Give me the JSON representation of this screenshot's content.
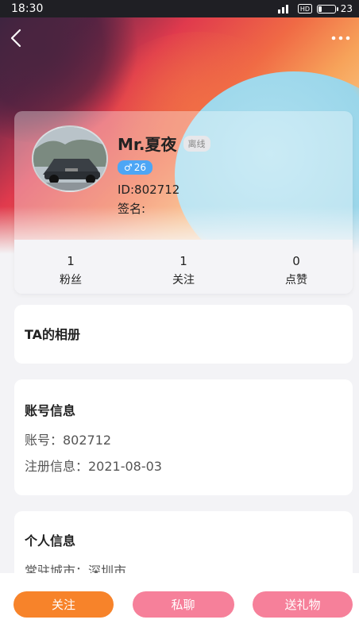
{
  "status_bar": {
    "time": "18:30",
    "battery": "23",
    "battery_fraction": 0.23
  },
  "nav": {
    "back_icon": "back-arrow-icon",
    "more_icon": "more-dots-icon"
  },
  "profile": {
    "name": "Mr.夏夜",
    "online_status": "离线",
    "gender_symbol": "♂",
    "age": "26",
    "id_line": "ID:802712",
    "signature_line": "签名:"
  },
  "stats": [
    {
      "value": "1",
      "label": "粉丝"
    },
    {
      "value": "1",
      "label": "关注"
    },
    {
      "value": "0",
      "label": "点赞"
    }
  ],
  "album": {
    "title": "TA的相册"
  },
  "account": {
    "title": "账号信息",
    "lines": [
      "账号：802712",
      "注册信息：2021-08-03"
    ]
  },
  "personal": {
    "title": "个人信息",
    "lines": [
      "常驻城市：深圳市"
    ]
  },
  "actions": {
    "follow": "关注",
    "chat": "私聊",
    "gift": "送礼物"
  },
  "colors": {
    "follow_button": "#f7832a",
    "pink_button": "#f6809a",
    "gender_tag": "#4da6f5"
  }
}
